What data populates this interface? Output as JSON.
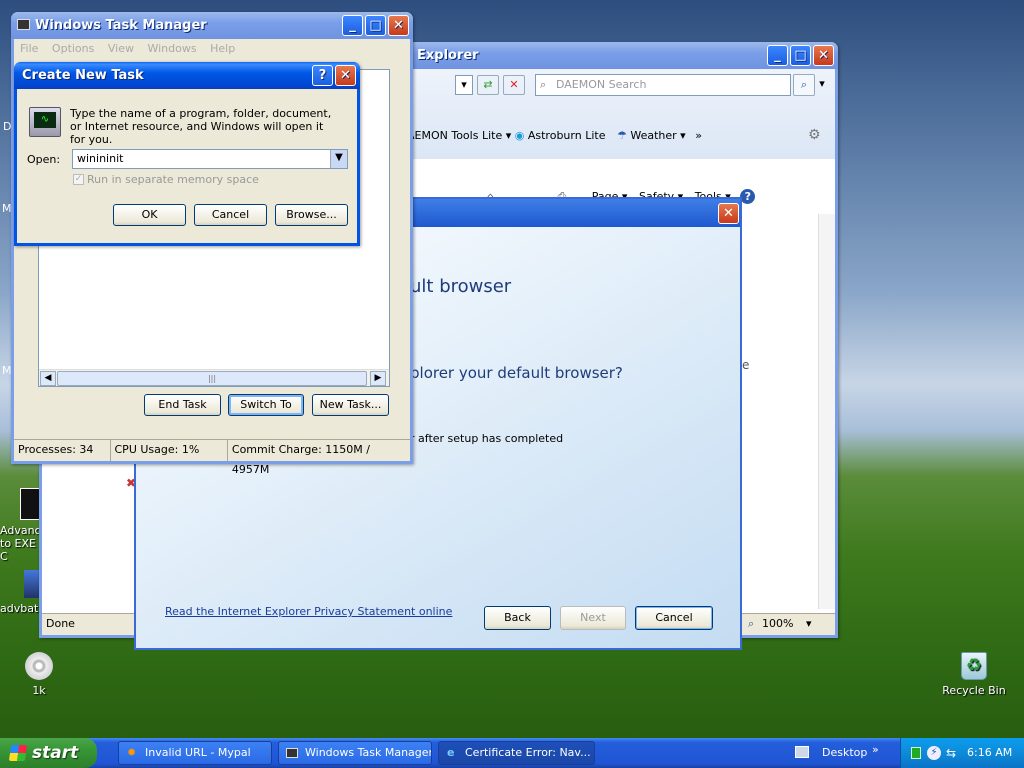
{
  "desktop": {
    "icons": [
      {
        "label": "Advanc to EXE C",
        "icon": "installer-icon"
      },
      {
        "label": "advbat",
        "icon": "batch-icon"
      },
      {
        "label": "1k",
        "icon": "cd-icon"
      },
      {
        "label": "Recycle Bin",
        "icon": "recycle-bin-icon"
      }
    ],
    "edge_letters": [
      "D",
      "M",
      "M"
    ]
  },
  "ie": {
    "title": "Explorer",
    "search_placeholder": "DAEMON Search",
    "links": [
      "AEMON Tools Lite",
      "Astroburn Lite",
      "Weather"
    ],
    "cmdbar": [
      "Page",
      "Safety",
      "Tools"
    ],
    "status": "Done",
    "zoom": "100%",
    "side_letter": "e"
  },
  "setup": {
    "heading": "ult browser",
    "question": "plorer your default browser?",
    "option": "r after setup has completed",
    "privacy_link": "Read the Internet Explorer Privacy Statement online",
    "back": "Back",
    "next": "Next",
    "cancel": "Cancel"
  },
  "taskmgr": {
    "title": "Windows Task Manager",
    "menu": [
      "File",
      "Options",
      "View",
      "Windows",
      "Help"
    ],
    "end_task": "End Task",
    "switch_to": "Switch To",
    "new_task": "New Task...",
    "status": {
      "processes": "Processes: 34",
      "cpu": "CPU Usage: 1%",
      "commit": "Commit Charge: 1150M / 4957M"
    }
  },
  "run": {
    "title": "Create New Task",
    "description": "Type the name of a program, folder, document, or Internet resource, and Windows will open it for you.",
    "open_label": "Open:",
    "open_value": "winininit",
    "checkbox": "Run in separate memory space",
    "ok": "OK",
    "cancel": "Cancel",
    "browse": "Browse..."
  },
  "taskbar": {
    "start": "start",
    "tasks": [
      "Invalid URL - Mypal",
      "Windows Task Manager",
      "Certificate Error: Nav..."
    ],
    "desktop_toolbar": "Desktop",
    "clock": "6:16 AM"
  },
  "colors": {
    "xp_blue": "#0054e3",
    "window_face": "#ece9d8",
    "start_green": "#379635",
    "tray_blue": "#0c9dee"
  }
}
